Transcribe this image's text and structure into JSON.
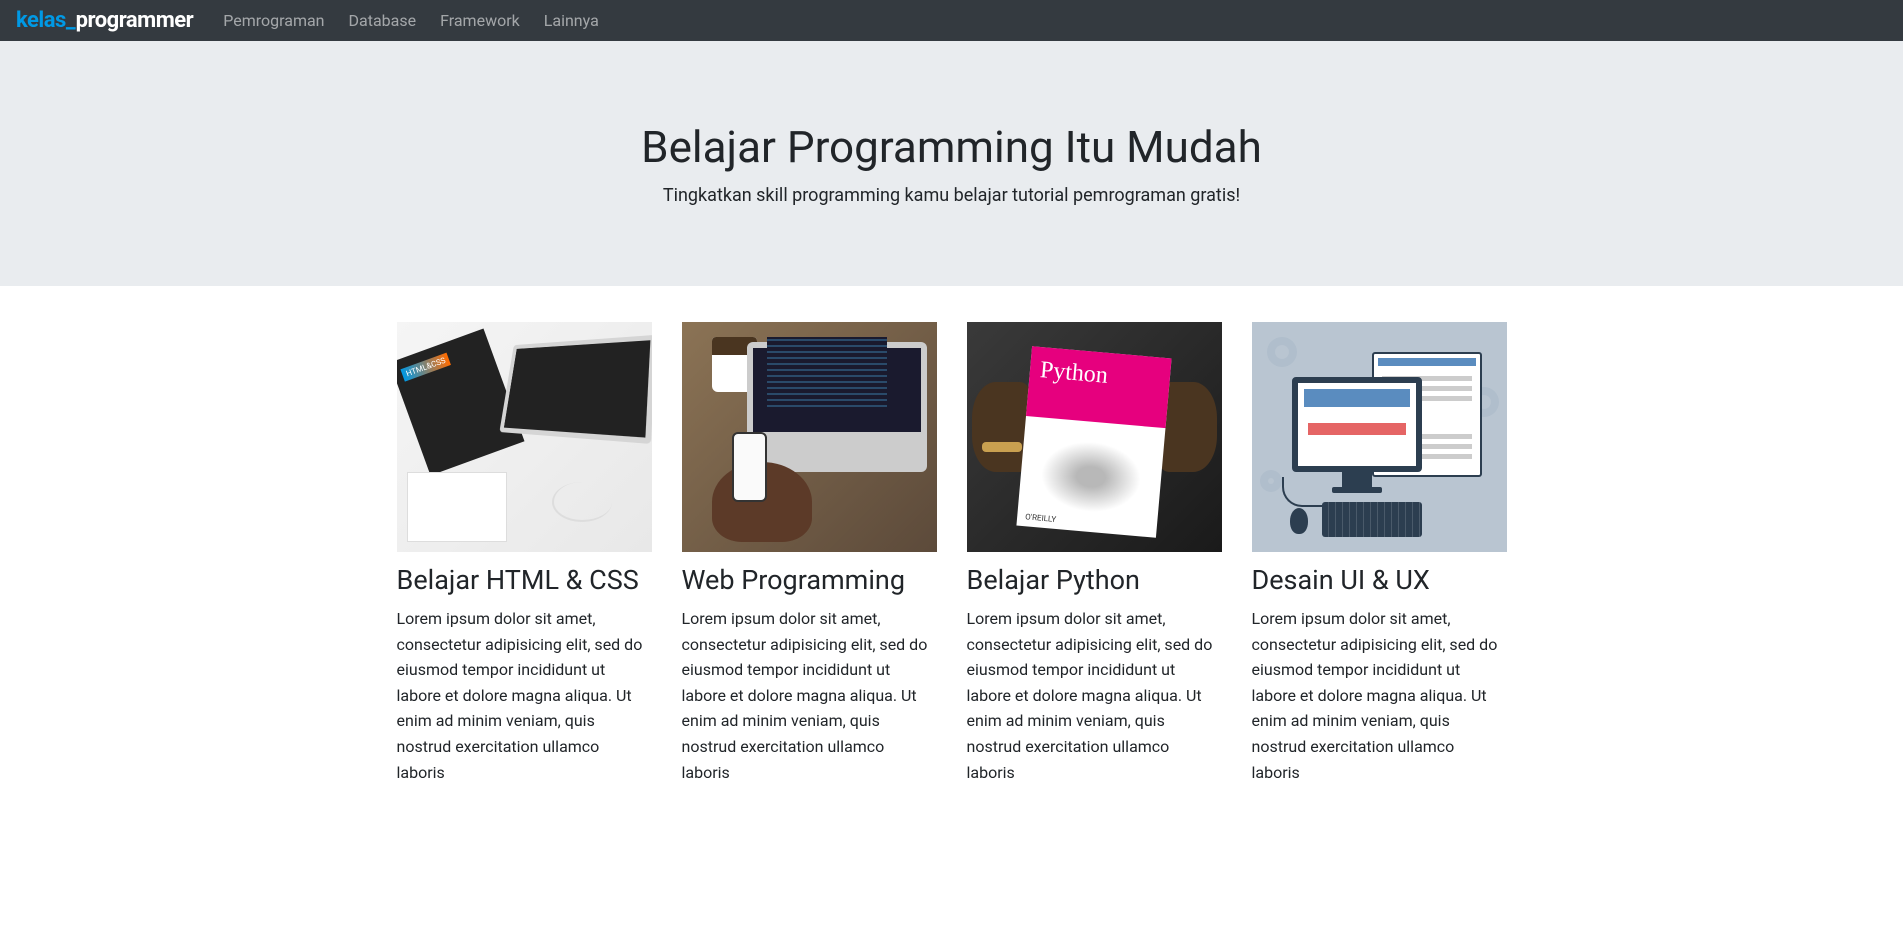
{
  "brand": {
    "part1": "kelas",
    "underscore": "_",
    "part2": "programmer"
  },
  "nav": {
    "items": [
      {
        "label": "Pemrograman"
      },
      {
        "label": "Database"
      },
      {
        "label": "Framework"
      },
      {
        "label": "Lainnya"
      }
    ]
  },
  "hero": {
    "title": "Belajar Programming Itu Mudah",
    "subtitle": "Tingkatkan skill programming kamu belajar tutorial pemrograman gratis!"
  },
  "cards": [
    {
      "title": "Belajar HTML & CSS",
      "text": "Lorem ipsum dolor sit amet, consectetur adipisicing elit, sed do eiusmod tempor incididunt ut labore et dolore magna aliqua. Ut enim ad minim veniam, quis nostrud exercitation ullamco laboris"
    },
    {
      "title": "Web Programming",
      "text": "Lorem ipsum dolor sit amet, consectetur adipisicing elit, sed do eiusmod tempor incididunt ut labore et dolore magna aliqua. Ut enim ad minim veniam, quis nostrud exercitation ullamco laboris"
    },
    {
      "title": "Belajar Python",
      "text": "Lorem ipsum dolor sit amet, consectetur adipisicing elit, sed do eiusmod tempor incididunt ut labore et dolore magna aliqua. Ut enim ad minim veniam, quis nostrud exercitation ullamco laboris"
    },
    {
      "title": "Desain UI & UX",
      "text": "Lorem ipsum dolor sit amet, consectetur adipisicing elit, sed do eiusmod tempor incididunt ut labore et dolore magna aliqua. Ut enim ad minim veniam, quis nostrud exercitation ullamco laboris"
    }
  ],
  "python_book_label": "Python",
  "python_book_publisher": "O'REILLY"
}
